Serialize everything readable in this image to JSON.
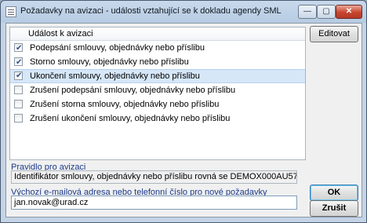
{
  "window": {
    "title": "Požadavky na avizaci - události vztahující se k dokladu agendy SML",
    "minimize_glyph": "—",
    "maximize_glyph": "▢",
    "close_glyph": "✕"
  },
  "events_list": {
    "column_header": "Událost k avizaci",
    "rows": [
      {
        "label": "Podepsání smlouvy, objednávky nebo příslibu",
        "checked": true,
        "selected": false
      },
      {
        "label": "Storno smlouvy, objednávky nebo příslibu",
        "checked": true,
        "selected": false
      },
      {
        "label": "Ukončení smlouvy, objednávky nebo příslibu",
        "checked": true,
        "selected": true
      },
      {
        "label": "Zrušení podepsání smlouvy, objednávky nebo příslibu",
        "checked": false,
        "selected": false
      },
      {
        "label": "Zrušení storna smlouvy, objednávky nebo příslibu",
        "checked": false,
        "selected": false
      },
      {
        "label": "Zrušení ukončení smlouvy, objednávky nebo příslibu",
        "checked": false,
        "selected": false
      }
    ]
  },
  "buttons": {
    "edit": "Editovat",
    "ok": "OK",
    "cancel": "Zrušit"
  },
  "rule": {
    "label": "Pravidlo pro avizaci",
    "value": "Identifikátor smlouvy, objednávky nebo příslibu rovná se DEMOX000AU57"
  },
  "contact": {
    "label": "Výchozí e-mailová adresa nebo telefonní číslo pro nové požadavky",
    "value": "jan.novak@urad.cz"
  },
  "icons": {
    "window_icon": "document-list-icon",
    "checkbox_check": "check-icon"
  }
}
